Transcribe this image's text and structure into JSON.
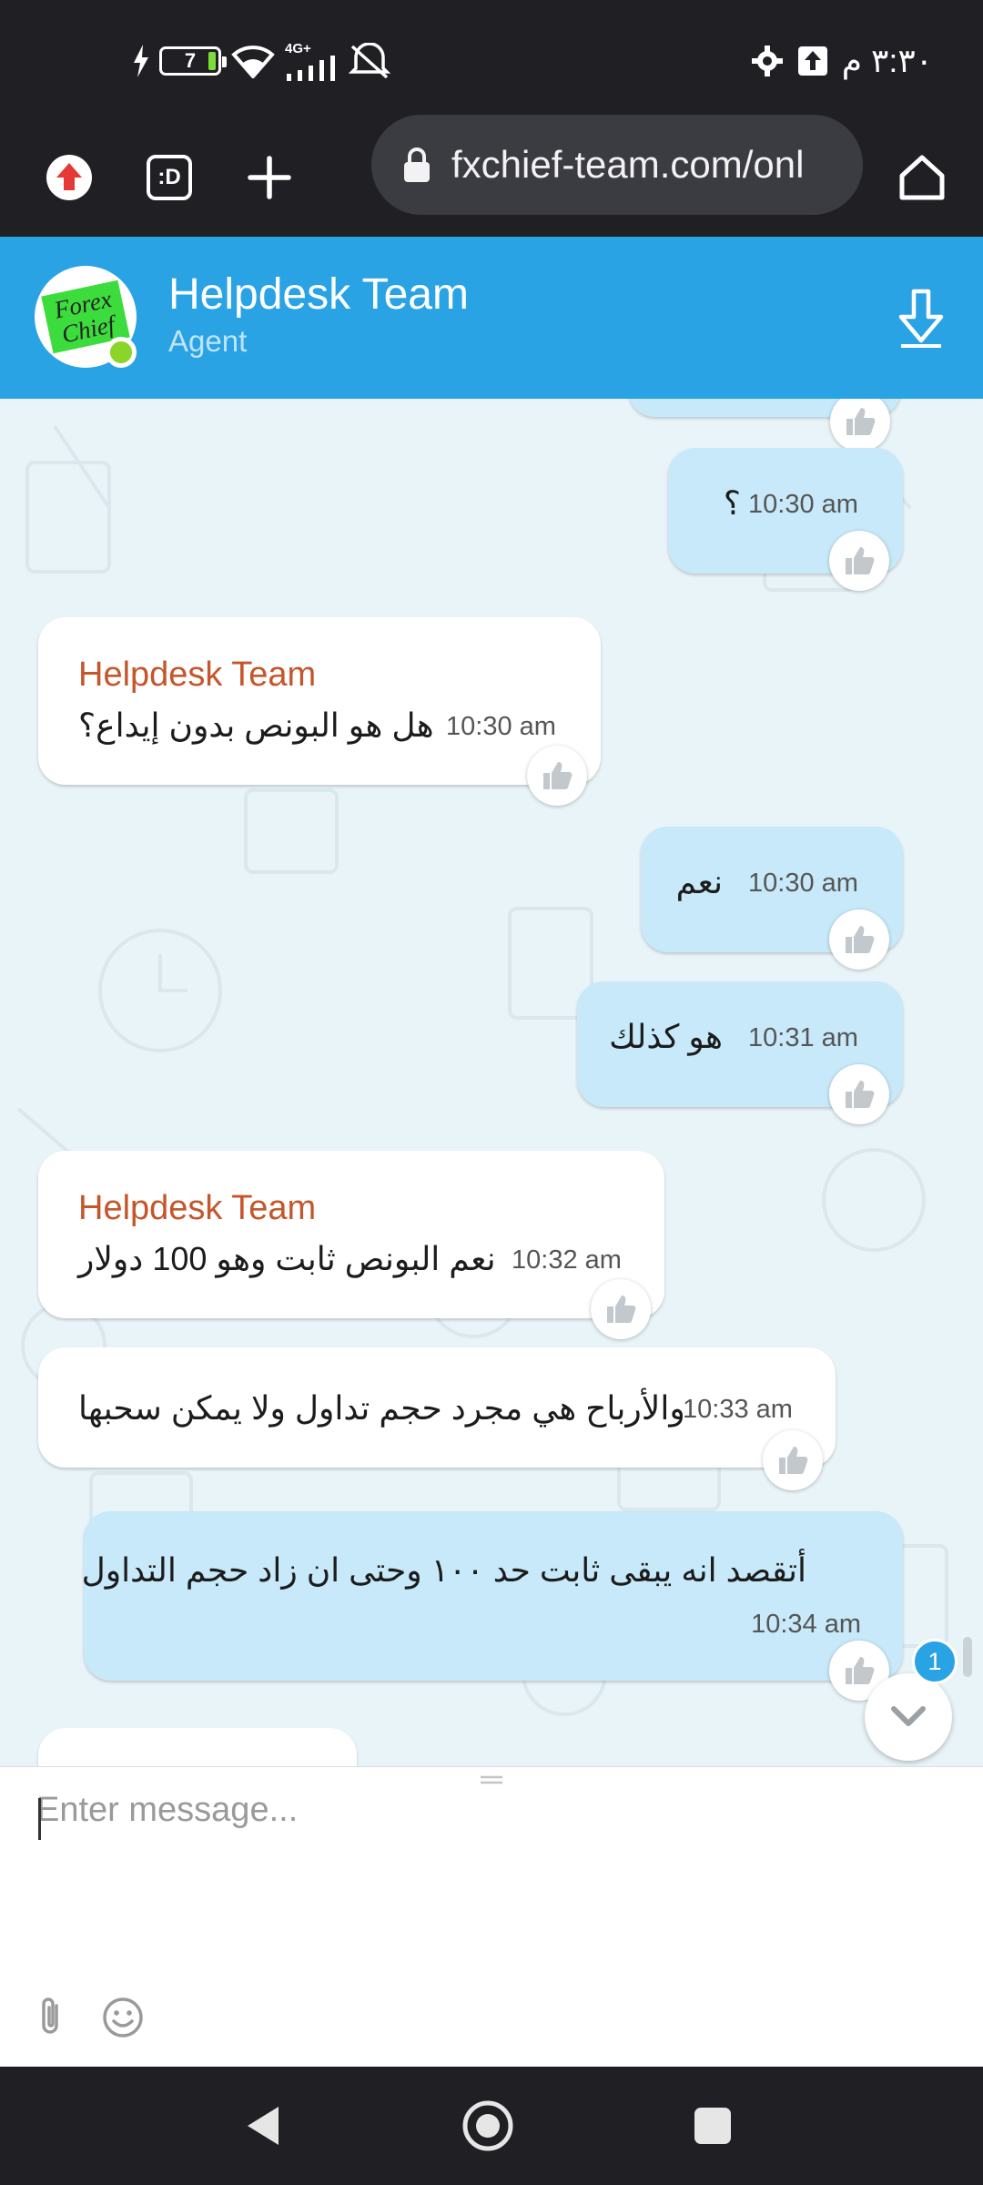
{
  "status_bar": {
    "time": "٣:٣٠ م",
    "battery_level": "7",
    "network_label": "4G+",
    "icons": [
      "charging-icon",
      "battery-icon",
      "wifi-icon",
      "signal-icon",
      "mute-icon",
      "upload-icon",
      "settings-icon"
    ]
  },
  "browser": {
    "url": "fxchief-team.com/onl",
    "tab_count_label": ":D",
    "icons": [
      "extension-icon",
      "tabs-icon",
      "new-tab-icon",
      "lock-icon",
      "home-icon"
    ]
  },
  "chat_header": {
    "agent_name": "Helpdesk Team",
    "agent_role": "Agent",
    "logo_text": "Forex Chief",
    "accent_color": "#2aa3e5",
    "online_color": "#8bd52b"
  },
  "messages": [
    {
      "from": "user",
      "text": "؟",
      "time": "10:30 am"
    },
    {
      "from": "agent",
      "sender": "Helpdesk Team",
      "text": "هل هو البونص بدون إيداع؟",
      "time": "10:30 am"
    },
    {
      "from": "user",
      "text": "نعم",
      "time": "10:30 am"
    },
    {
      "from": "user",
      "text": "هو كذلك",
      "time": "10:31 am"
    },
    {
      "from": "agent",
      "sender": "Helpdesk Team",
      "text": "نعم البونص ثابت وهو 100 دولار",
      "time": "10:32 am"
    },
    {
      "from": "agent",
      "text": "والأرباح هي مجرد حجم تداول ولا يمكن سحبها",
      "time": "10:33 am"
    },
    {
      "from": "user",
      "text": "أتقصد انه يبقى ثابت حد ١٠٠ وحتى ان زاد حجم التداول",
      "time": "10:34 am"
    }
  ],
  "unread_count": "1",
  "composer": {
    "placeholder": "Enter message...",
    "icons": [
      "attach-icon",
      "emoji-icon"
    ]
  },
  "nav": {
    "icons": [
      "back-icon",
      "home-circle-icon",
      "recents-icon"
    ]
  }
}
